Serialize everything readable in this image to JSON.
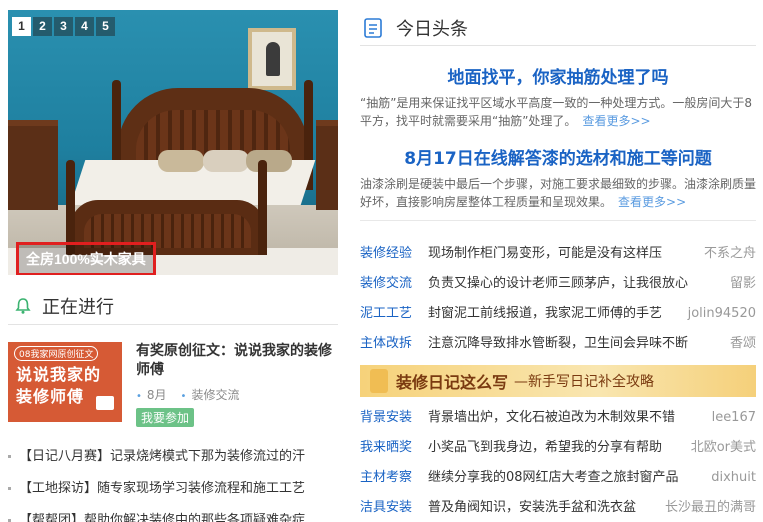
{
  "slider": {
    "pages": [
      "1",
      "2",
      "3",
      "4",
      "5"
    ],
    "active_index": 0,
    "caption": "全房100%实木家具"
  },
  "ongoing": {
    "title": "正在进行",
    "promo": {
      "image_tag": "08我家网原创征文",
      "image_text": "说说我家的装修师傅",
      "title": "有奖原创征文：说说我家的装修师傅",
      "month": "8月",
      "category": "装修交流",
      "join_label": "我要参加"
    },
    "items": [
      "【日记八月赛】记录烧烤模式下那为装修流过的汗",
      "【工地探访】随专家现场学习装修流程和施工工艺",
      "【帮帮团】帮助你解决装修中的那些各项疑难杂症"
    ]
  },
  "headlines": {
    "title": "今日头条",
    "articles": [
      {
        "title": "地面找平，你家抽筋处理了吗",
        "summary": "“抽筋”是用来保证找平区域水平高度一致的一种处理方式。一般房间大于8平方，找平时就需要采用“抽筋”处理了。",
        "more": "查看更多>>"
      },
      {
        "title": "8月17日在线解答漆的选材和施工等问题",
        "summary": "油漆涂刷是硬装中最后一个步骤，对施工要求最细致的步骤。油漆涂刷质量好坏，直接影响房屋整体工程质量和呈现效果。",
        "more": "查看更多>>"
      }
    ]
  },
  "topics_top": [
    {
      "category": "装修经验",
      "text": "现场制作柜门易变形，可能是没有这样压",
      "user": "不系之舟"
    },
    {
      "category": "装修交流",
      "text": "负责又操心的设计老师三顾茅庐，让我很放心",
      "user": "留影"
    },
    {
      "category": "泥工工艺",
      "text": "封窗泥工前线报道，我家泥工师傅的手艺",
      "user": "jolin94520"
    },
    {
      "category": "主体改拆",
      "text": "注意沉降导致排水管断裂，卫生间会异味不断",
      "user": "香颂"
    }
  ],
  "banner": {
    "title": "装修日记这么写",
    "subtitle": "—新手写日记补全攻略"
  },
  "topics_bottom": [
    {
      "category": "背景安装",
      "text": "背景墙出炉，文化石被迫改为木制效果不错",
      "user": "lee167"
    },
    {
      "category": "我来晒奖",
      "text": "小奖品飞到我身边，希望我的分享有帮助",
      "user": "北欧or美式"
    },
    {
      "category": "主材考察",
      "text": "继续分享我的08网红店大考查之旅封窗产品",
      "user": "dixhuit"
    },
    {
      "category": "洁具安装",
      "text": "普及角阀知识，安装洗手盆和洗衣盆",
      "user": "长沙最丑的满哥"
    }
  ],
  "colors": {
    "link_blue": "#1a63c4",
    "caption_border": "#e01f1f",
    "join_green": "#6cc287"
  }
}
